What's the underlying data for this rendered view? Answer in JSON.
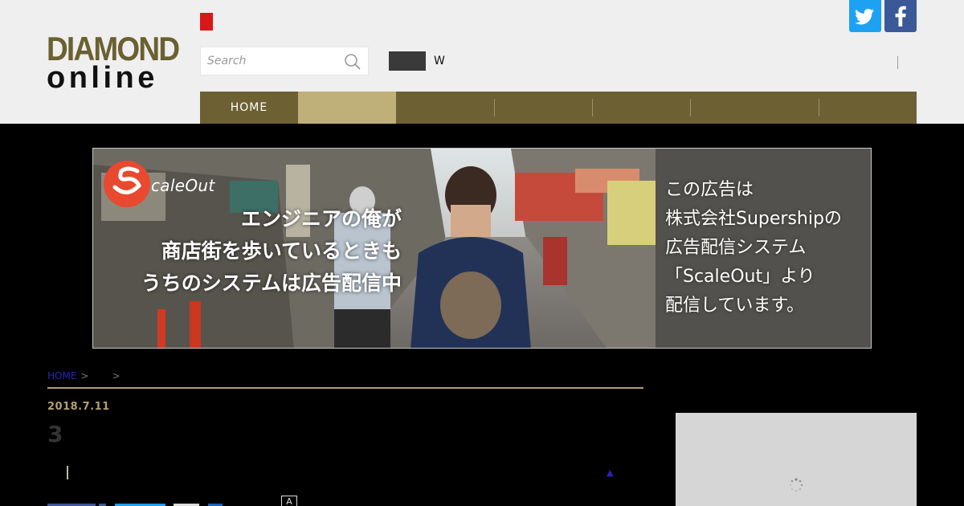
{
  "header": {
    "logo_line1": "DIAMOND",
    "logo_line2": "online",
    "search": {
      "placeholder": "Search",
      "value": ""
    },
    "w_text": "W",
    "colors": {
      "logo_gold": "#6b6031",
      "red_mark": "#d71718",
      "nav_bg": "#6d6033",
      "nav_active": "#bfb07a",
      "twitter": "#1da1f2",
      "facebook": "#3b5998"
    },
    "icons": [
      "search-icon",
      "twitter-icon",
      "facebook-icon"
    ]
  },
  "nav": {
    "items": [
      {
        "label": "HOME",
        "active": false
      },
      {
        "label": "",
        "active": true
      },
      {
        "label": "",
        "active": false
      },
      {
        "label": "",
        "active": false
      },
      {
        "label": "",
        "active": false
      },
      {
        "label": "",
        "active": false
      },
      {
        "label": "",
        "active": false
      }
    ]
  },
  "ad": {
    "brand": "caleOut",
    "left_lines": [
      "エンジニアの俺が",
      "商店街を歩いているときも",
      "うちのシステムは広告配信中"
    ],
    "right_lines": [
      "この広告は",
      "株式会社Supershipの",
      "広告配信システム",
      "「ScaleOut」より",
      "配信しています。"
    ]
  },
  "article": {
    "breadcrumb": {
      "home": "HOME",
      "sep": ">"
    },
    "date": "2018.7.11",
    "title": "3",
    "font_size_label": "A"
  }
}
